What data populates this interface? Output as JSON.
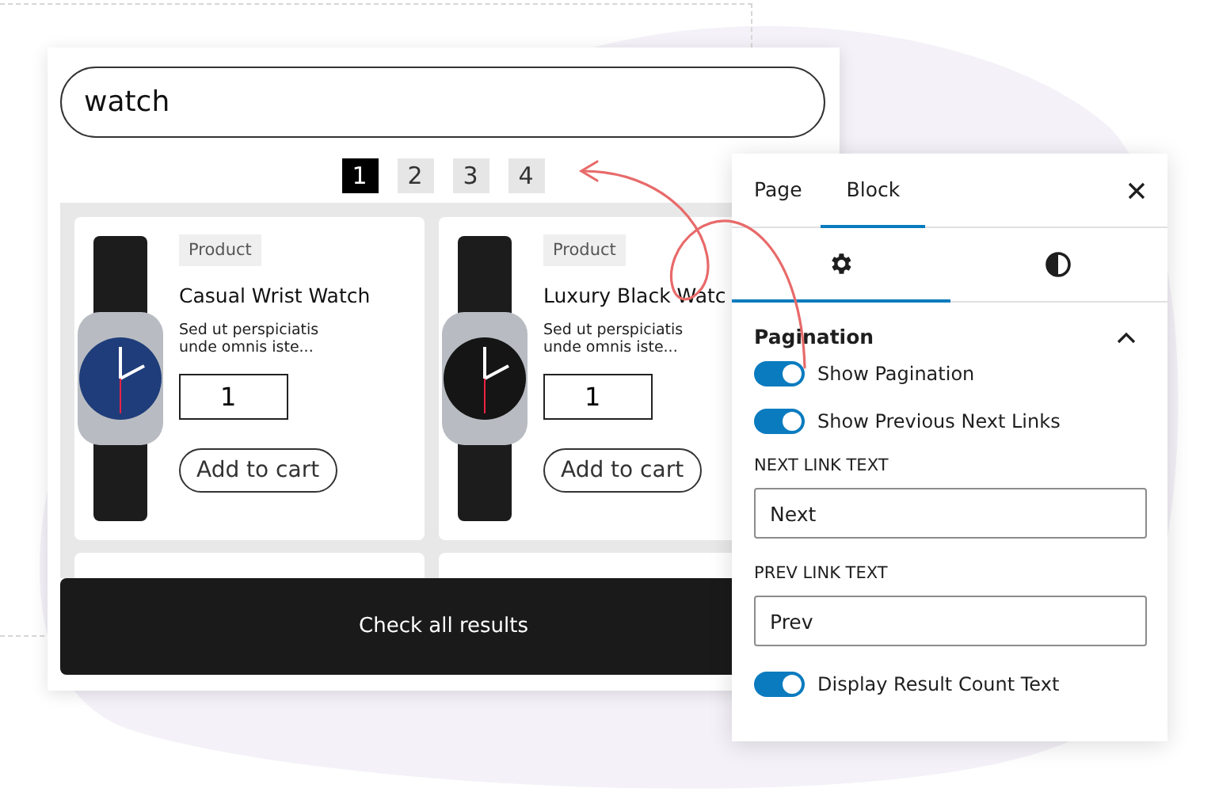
{
  "search": {
    "value": "watch"
  },
  "pagination": [
    {
      "label": "1",
      "selected": true
    },
    {
      "label": "2",
      "selected": false
    },
    {
      "label": "3",
      "selected": false
    },
    {
      "label": "4",
      "selected": false
    }
  ],
  "products": [
    {
      "kind": "blue-dial",
      "tag": "Product",
      "title": "Casual Wrist Watch",
      "excerpt": "Sed ut perspiciatis unde omnis iste...",
      "quantity": "1",
      "button": "Add to cart"
    },
    {
      "kind": "black-dial",
      "tag": "Product",
      "title": "Luxury Black Watc",
      "excerpt": "Sed ut perspiciatis unde omnis iste...",
      "quantity": "1",
      "button": "Add to cart"
    }
  ],
  "results_button": "Check all results",
  "panel": {
    "tabs": [
      {
        "label": "Page",
        "selected": false
      },
      {
        "label": "Block",
        "selected": true
      }
    ],
    "subtabs": [
      {
        "kind": "settings",
        "selected": true
      },
      {
        "kind": "styles",
        "selected": false
      }
    ],
    "section": {
      "title": "Pagination",
      "expanded": true,
      "controls": [
        {
          "kind": "toggle",
          "label": "Show Pagination",
          "on": true
        },
        {
          "kind": "toggle",
          "label": "Show Previous Next Links",
          "on": true
        },
        {
          "kind": "text",
          "label": "NEXT LINK TEXT",
          "value": "Next"
        },
        {
          "kind": "text",
          "label": "PREV LINK TEXT",
          "value": "Prev"
        },
        {
          "kind": "toggle",
          "label": "Display Result Count Text",
          "on": true
        }
      ]
    }
  }
}
